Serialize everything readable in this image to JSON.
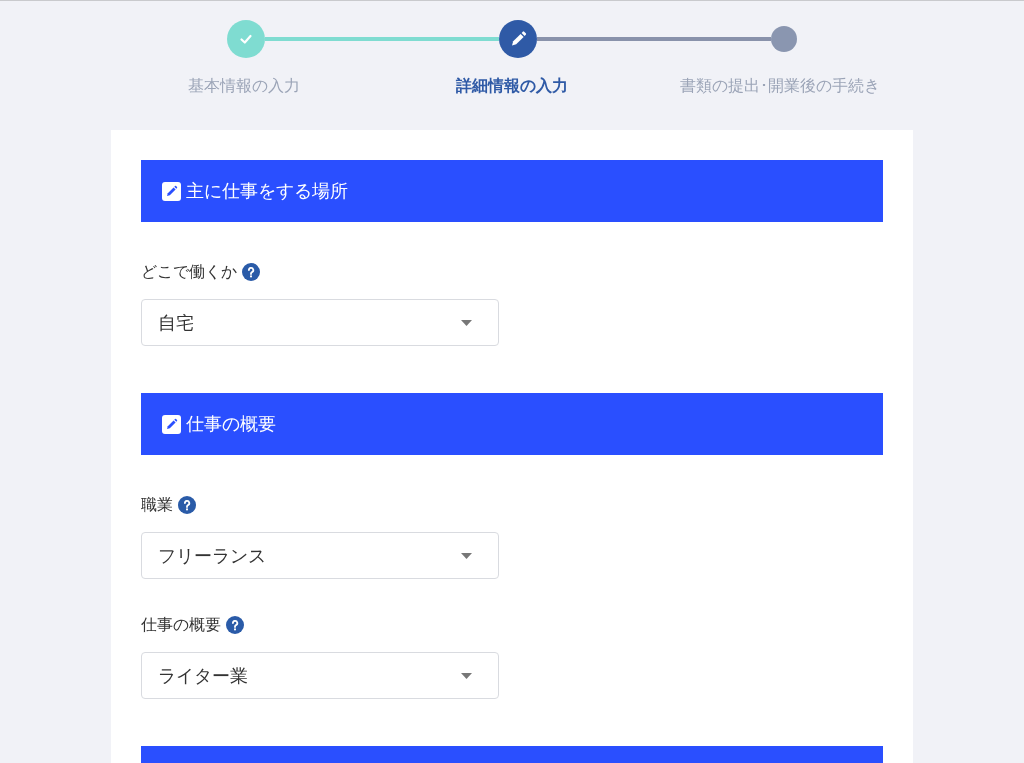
{
  "stepper": {
    "steps": [
      {
        "label": "基本情報の入力",
        "completed": true,
        "selected": false
      },
      {
        "label": "詳細情報の入力",
        "completed": false,
        "selected": true
      },
      {
        "label": "書類の提出･開業後の手続き",
        "completed": false,
        "selected": false
      }
    ]
  },
  "sections": [
    {
      "kind": "full",
      "title": "主に仕事をする場所",
      "fields": [
        {
          "label": "どこで働くか",
          "help": true,
          "value": "自宅"
        }
      ]
    },
    {
      "kind": "full",
      "title": "仕事の概要",
      "fields": [
        {
          "label": "職業",
          "help": true,
          "value": "フリーランス"
        },
        {
          "label": "仕事の概要",
          "help": true,
          "value": "ライター業"
        }
      ]
    },
    {
      "kind": "cut"
    }
  ]
}
